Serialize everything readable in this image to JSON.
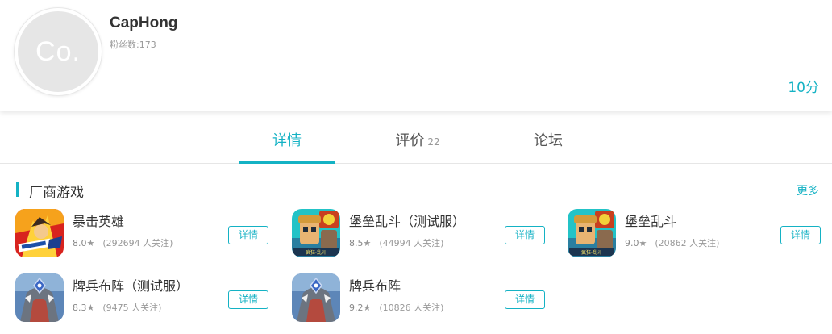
{
  "profile": {
    "avatar_text": "Co.",
    "name": "CapHong",
    "fans_label": "粉丝数:",
    "fans_count": "173",
    "score": "10分"
  },
  "tabs": [
    {
      "label": "详情",
      "count": ""
    },
    {
      "label": "评价",
      "count": "22"
    },
    {
      "label": "论坛",
      "count": ""
    }
  ],
  "section": {
    "title": "厂商游戏",
    "more_label": "更多"
  },
  "games": [
    {
      "name": "暴击英雄",
      "rating": "8.0",
      "followers": "(292694 人关注)",
      "button": "详情",
      "icon": "hero-game-icon"
    },
    {
      "name": "堡垒乱斗（测试服）",
      "rating": "8.5",
      "followers": "(44994 人关注)",
      "button": "详情",
      "icon": "fortress-game-icon"
    },
    {
      "name": "堡垒乱斗",
      "rating": "9.0",
      "followers": "(20862 人关注)",
      "button": "详情",
      "icon": "fortress-game-icon"
    },
    {
      "name": "牌兵布阵（测试服）",
      "rating": "8.3",
      "followers": "(9475 人关注)",
      "button": "详情",
      "icon": "dragon-game-icon"
    },
    {
      "name": "牌兵布阵",
      "rating": "9.2",
      "followers": "(10826 人关注)",
      "button": "详情",
      "icon": "dragon-game-icon"
    }
  ],
  "colors": {
    "accent": "#14b2c4",
    "avatar_bg": "#e6e6e6",
    "text_primary": "#333333",
    "text_secondary": "#999999"
  }
}
